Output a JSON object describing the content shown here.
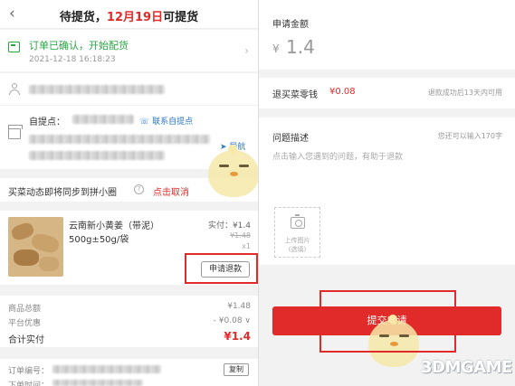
{
  "left": {
    "header": {
      "back_icon": "chevron-left-icon",
      "title_prefix": "待提货，",
      "title_date": "12月19日",
      "title_suffix": "可提货"
    },
    "status": {
      "text": "订单已确认，开始配货",
      "datetime": "2021-12-18 16:18:23"
    },
    "pickup": {
      "label": "自提点：",
      "contact_link": "联系自提点",
      "nav_link": "导航"
    },
    "sync": {
      "text": "买菜动态即将同步到拼小圈",
      "cancel": "点击取消"
    },
    "item": {
      "name": "云南新小黄姜（带泥）",
      "spec": "500g±50g/袋",
      "paid": "实付：¥1.4",
      "original": "¥1.48",
      "qty": "x1",
      "refund_button": "申请退款"
    },
    "totals": {
      "rows": [
        {
          "label": "商品总额",
          "value": "¥1.48"
        },
        {
          "label": "平台优惠",
          "value": "- ¥0.08 ∨"
        },
        {
          "label": "合计实付",
          "value": "¥1.4"
        }
      ]
    },
    "order": {
      "number_label": "订单编号：",
      "copy_button": "复制",
      "time_label": "下单时间："
    }
  },
  "right": {
    "amount": {
      "label": "申请金额",
      "currency": "¥",
      "value": "1.4"
    },
    "rmb": {
      "label": "退买菜零钱",
      "value": "¥0.08",
      "note": "退款成功后13天内可用"
    },
    "desc": {
      "label": "问题描述",
      "limit": "您还可以输入170字",
      "placeholder": "点击输入您遇到的问题，有助于退款"
    },
    "upload": {
      "line1": "上传图片",
      "line2": "(选填)"
    },
    "submit": "提交申请"
  },
  "watermark": "3DMGAME",
  "colors": {
    "accent_red": "#e12a2a",
    "status_green": "#2aa546",
    "link_blue": "#2a76c8"
  }
}
